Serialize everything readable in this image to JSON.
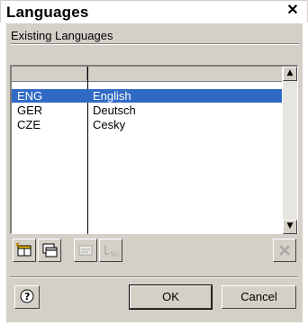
{
  "window": {
    "title": "Languages",
    "close_label": "x"
  },
  "group": {
    "label": "Existing Languages"
  },
  "languages": [
    {
      "code": "ENG",
      "name": "English",
      "selected": true
    },
    {
      "code": "GER",
      "name": "Deutsch",
      "selected": false
    },
    {
      "code": "CZE",
      "name": "Cesky",
      "selected": false
    }
  ],
  "toolbar": {
    "icons": [
      "new-language-icon",
      "copy-language-icon",
      "edit-language-icon",
      "language-settings-icon",
      "delete-icon"
    ]
  },
  "buttons": {
    "ok": "OK",
    "cancel": "Cancel"
  },
  "colors": {
    "selection": "#316ac5",
    "face": "#d4d0c8"
  }
}
